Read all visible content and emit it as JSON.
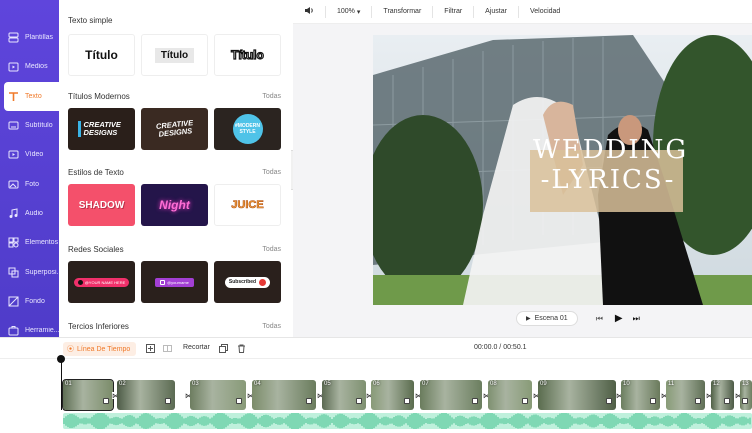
{
  "sidebar": {
    "items": [
      {
        "label": "Plantillas",
        "icon": "template-icon"
      },
      {
        "label": "Medios",
        "icon": "media-folder-icon"
      },
      {
        "label": "Texto",
        "icon": "text-icon"
      },
      {
        "label": "Subtítulo",
        "icon": "subtitle-icon"
      },
      {
        "label": "Vídeo",
        "icon": "video-icon"
      },
      {
        "label": "Foto",
        "icon": "photo-icon"
      },
      {
        "label": "Audio",
        "icon": "audio-icon"
      },
      {
        "label": "Elementos",
        "icon": "elements-icon"
      },
      {
        "label": "Superposi...",
        "icon": "overlay-icon"
      },
      {
        "label": "Fondo",
        "icon": "background-icon"
      },
      {
        "label": "Herramie...",
        "icon": "tools-icon"
      }
    ],
    "active_index": 2,
    "accent": "#f07a2a",
    "bg": "#5f45dc"
  },
  "panel": {
    "sections": [
      {
        "title": "Texto simple",
        "all": ""
      },
      {
        "title": "Títulos Modernos",
        "all": "Todas"
      },
      {
        "title": "Estilos de Texto",
        "all": "Todas"
      },
      {
        "title": "Redes Sociales",
        "all": "Todas"
      },
      {
        "title": "Tercios Inferiores",
        "all": "Todas"
      }
    ],
    "simple": [
      "Título",
      "Título",
      "Título"
    ],
    "modern": [
      "CREATIVE DESIGNS",
      "CREATIVE DESIGNS",
      "#MODERN STYLE"
    ],
    "styles": [
      "SHADOW",
      "Night",
      "JUICE"
    ],
    "social": [
      "@YOUR NAME HERE",
      "@yourname",
      "Subscribed"
    ]
  },
  "toolbar": {
    "zoom": "100%",
    "items": [
      "Transformar",
      "Filtrar",
      "Ajustar",
      "Velocidad"
    ]
  },
  "preview": {
    "title_line1": "WEDDING",
    "title_line2": "-LYRICS-",
    "scene_label": "Escena 01"
  },
  "timeline": {
    "tab_label": "Línea De Tiempo",
    "recortar": "Recortar",
    "timecode": "00:00.0 / 00:50.1",
    "clips": [
      "01",
      "02",
      "03",
      "04",
      "05",
      "06",
      "07",
      "08",
      "09",
      "10",
      "11",
      "12",
      "13"
    ]
  }
}
